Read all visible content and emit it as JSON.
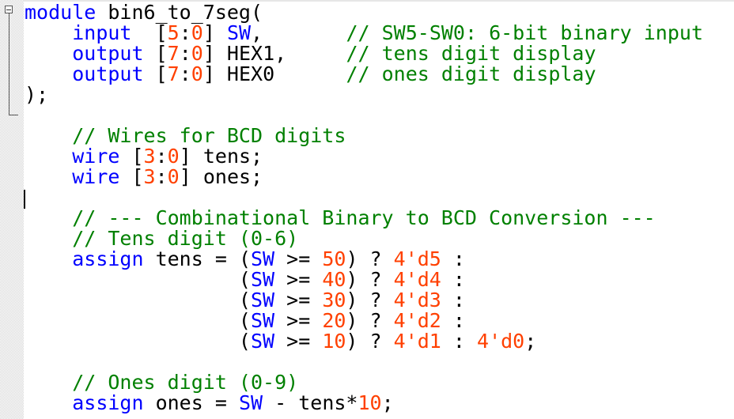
{
  "editor": {
    "lines": [
      [
        {
          "t": "kw",
          "v": "module"
        },
        {
          "t": "op",
          "v": " bin6_to_7seg("
        }
      ],
      [
        {
          "t": "op",
          "v": "    "
        },
        {
          "t": "kw",
          "v": "input"
        },
        {
          "t": "op",
          "v": "  ["
        },
        {
          "t": "num",
          "v": "5"
        },
        {
          "t": "op",
          "v": ":"
        },
        {
          "t": "num",
          "v": "0"
        },
        {
          "t": "op",
          "v": "] "
        },
        {
          "t": "kw",
          "v": "SW"
        },
        {
          "t": "op",
          "v": ",       "
        },
        {
          "t": "cm",
          "v": "// SW5-SW0: 6-bit binary input"
        }
      ],
      [
        {
          "t": "op",
          "v": "    "
        },
        {
          "t": "kw",
          "v": "output"
        },
        {
          "t": "op",
          "v": " ["
        },
        {
          "t": "num",
          "v": "7"
        },
        {
          "t": "op",
          "v": ":"
        },
        {
          "t": "num",
          "v": "0"
        },
        {
          "t": "op",
          "v": "] HEX1,     "
        },
        {
          "t": "cm",
          "v": "// tens digit display"
        }
      ],
      [
        {
          "t": "op",
          "v": "    "
        },
        {
          "t": "kw",
          "v": "output"
        },
        {
          "t": "op",
          "v": " ["
        },
        {
          "t": "num",
          "v": "7"
        },
        {
          "t": "op",
          "v": ":"
        },
        {
          "t": "num",
          "v": "0"
        },
        {
          "t": "op",
          "v": "] HEX0      "
        },
        {
          "t": "cm",
          "v": "// ones digit display"
        }
      ],
      [
        {
          "t": "op",
          "v": ");"
        }
      ],
      [
        {
          "t": "op",
          "v": ""
        }
      ],
      [
        {
          "t": "op",
          "v": "    "
        },
        {
          "t": "cm",
          "v": "// Wires for BCD digits"
        }
      ],
      [
        {
          "t": "op",
          "v": "    "
        },
        {
          "t": "kw",
          "v": "wire"
        },
        {
          "t": "op",
          "v": " ["
        },
        {
          "t": "num",
          "v": "3"
        },
        {
          "t": "op",
          "v": ":"
        },
        {
          "t": "num",
          "v": "0"
        },
        {
          "t": "op",
          "v": "] tens;"
        }
      ],
      [
        {
          "t": "op",
          "v": "    "
        },
        {
          "t": "kw",
          "v": "wire"
        },
        {
          "t": "op",
          "v": " ["
        },
        {
          "t": "num",
          "v": "3"
        },
        {
          "t": "op",
          "v": ":"
        },
        {
          "t": "num",
          "v": "0"
        },
        {
          "t": "op",
          "v": "] ones;"
        }
      ],
      [
        {
          "t": "op",
          "v": ""
        }
      ],
      [
        {
          "t": "op",
          "v": "    "
        },
        {
          "t": "cm",
          "v": "// --- Combinational Binary to BCD Conversion ---"
        }
      ],
      [
        {
          "t": "op",
          "v": "    "
        },
        {
          "t": "cm",
          "v": "// Tens digit (0-6)"
        }
      ],
      [
        {
          "t": "op",
          "v": "    "
        },
        {
          "t": "kw",
          "v": "assign"
        },
        {
          "t": "op",
          "v": " tens = ("
        },
        {
          "t": "kw",
          "v": "SW"
        },
        {
          "t": "op",
          "v": " >= "
        },
        {
          "t": "num",
          "v": "50"
        },
        {
          "t": "op",
          "v": ") ? "
        },
        {
          "t": "num",
          "v": "4'd5"
        },
        {
          "t": "op",
          "v": " :"
        }
      ],
      [
        {
          "t": "op",
          "v": "                  ("
        },
        {
          "t": "kw",
          "v": "SW"
        },
        {
          "t": "op",
          "v": " >= "
        },
        {
          "t": "num",
          "v": "40"
        },
        {
          "t": "op",
          "v": ") ? "
        },
        {
          "t": "num",
          "v": "4'd4"
        },
        {
          "t": "op",
          "v": " :"
        }
      ],
      [
        {
          "t": "op",
          "v": "                  ("
        },
        {
          "t": "kw",
          "v": "SW"
        },
        {
          "t": "op",
          "v": " >= "
        },
        {
          "t": "num",
          "v": "30"
        },
        {
          "t": "op",
          "v": ") ? "
        },
        {
          "t": "num",
          "v": "4'd3"
        },
        {
          "t": "op",
          "v": " :"
        }
      ],
      [
        {
          "t": "op",
          "v": "                  ("
        },
        {
          "t": "kw",
          "v": "SW"
        },
        {
          "t": "op",
          "v": " >= "
        },
        {
          "t": "num",
          "v": "20"
        },
        {
          "t": "op",
          "v": ") ? "
        },
        {
          "t": "num",
          "v": "4'd2"
        },
        {
          "t": "op",
          "v": " :"
        }
      ],
      [
        {
          "t": "op",
          "v": "                  ("
        },
        {
          "t": "kw",
          "v": "SW"
        },
        {
          "t": "op",
          "v": " >= "
        },
        {
          "t": "num",
          "v": "10"
        },
        {
          "t": "op",
          "v": ") ? "
        },
        {
          "t": "num",
          "v": "4'd1"
        },
        {
          "t": "op",
          "v": " : "
        },
        {
          "t": "num",
          "v": "4'd0"
        },
        {
          "t": "op",
          "v": ";"
        }
      ],
      [
        {
          "t": "op",
          "v": ""
        }
      ],
      [
        {
          "t": "op",
          "v": "    "
        },
        {
          "t": "cm",
          "v": "// Ones digit (0-9)"
        }
      ],
      [
        {
          "t": "op",
          "v": "    "
        },
        {
          "t": "kw",
          "v": "assign"
        },
        {
          "t": "op",
          "v": " ones = "
        },
        {
          "t": "kw",
          "v": "SW"
        },
        {
          "t": "op",
          "v": " - tens*"
        },
        {
          "t": "num",
          "v": "10"
        },
        {
          "t": "op",
          "v": ";"
        }
      ]
    ]
  },
  "colors": {
    "keyword": "#0000ff",
    "number": "#ff4000",
    "comment": "#008000",
    "text": "#000000",
    "background": "#ffffff"
  },
  "icons": {
    "fold": "fold-collapse-icon"
  }
}
